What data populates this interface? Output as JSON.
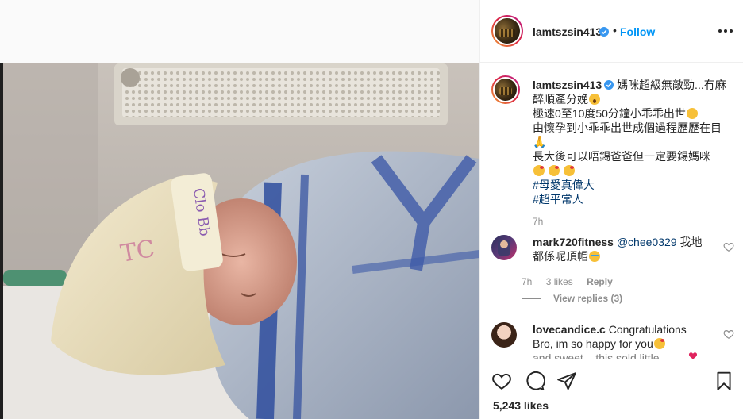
{
  "post": {
    "username": "lamtszsin413",
    "follow_label": "Follow",
    "dot": "•",
    "caption_lines": [
      "媽咪超級無敵勁...冇麻",
      "醉順產分娩",
      "極速0至10度50分鐘小乖乖出世",
      "由懷孕到小乖乖出世成個過程歷歷在目",
      "🙏",
      "長大後可以唔錫爸爸但一定要錫媽咪"
    ],
    "hashtags": [
      "#母愛真偉大",
      "#超平常人"
    ],
    "caption_time": "7h",
    "likes": "5,243 likes"
  },
  "comments": [
    {
      "username": "mark720fitness",
      "mention": "@chee0329",
      "text_after_mention": " 我地",
      "text_line2": "都係呢頂帽",
      "time": "7h",
      "likes": "3 likes",
      "reply_label": "Reply",
      "view_replies": "View replies (3)"
    },
    {
      "username": "lovecandice.c",
      "text": " Congratulations",
      "text_line2": "Bro, im so happy for you",
      "text_line3": "and sweet... this sold little..."
    }
  ],
  "colors": {
    "accent": "#0095f6",
    "hashtag": "#00376b",
    "muted": "#8e8e8e"
  },
  "icons": [
    "more-icon",
    "verified-icon",
    "heart-icon",
    "comment-icon",
    "share-icon",
    "bookmark-icon"
  ]
}
